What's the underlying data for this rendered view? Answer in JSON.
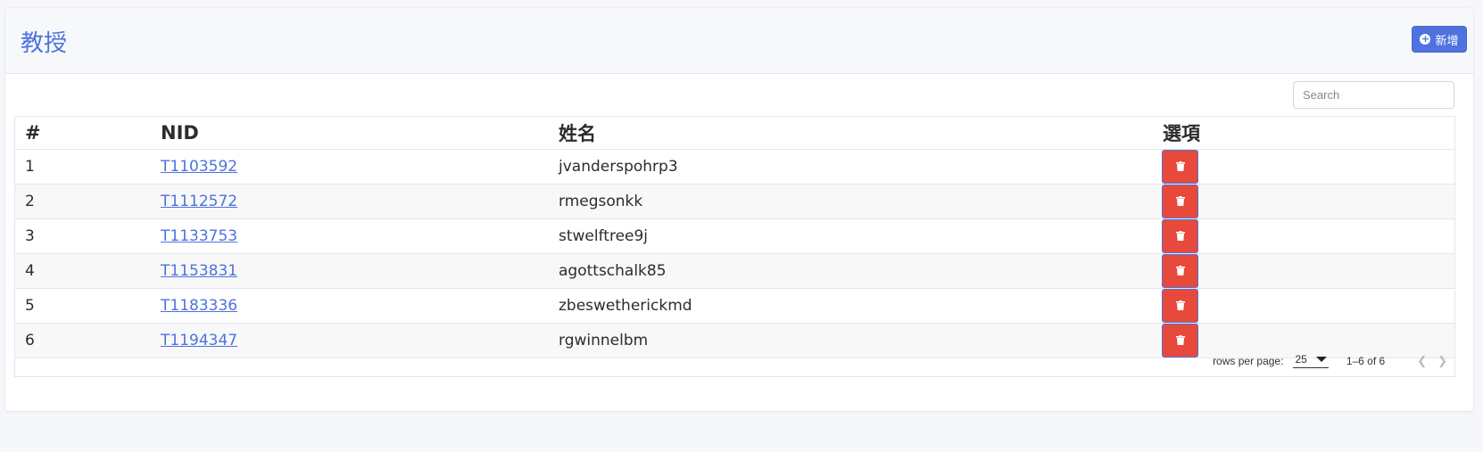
{
  "header": {
    "title": "教授",
    "add_label": "新增"
  },
  "search": {
    "placeholder": "Search"
  },
  "table": {
    "columns": [
      "#",
      "NID",
      "姓名",
      "選項"
    ],
    "rows": [
      {
        "idx": "1",
        "nid": "T1103592",
        "name": "jvanderspohrp3"
      },
      {
        "idx": "2",
        "nid": "T1112572",
        "name": "rmegsonkk"
      },
      {
        "idx": "3",
        "nid": "T1133753",
        "name": "stwelftree9j"
      },
      {
        "idx": "4",
        "nid": "T1153831",
        "name": "agottschalk85"
      },
      {
        "idx": "5",
        "nid": "T1183336",
        "name": "zbeswetherickmd"
      },
      {
        "idx": "6",
        "nid": "T1194347",
        "name": "rgwinnelbm"
      }
    ]
  },
  "pagination": {
    "rows_per_page_label": "rows per page:",
    "rows_per_page_value": "25",
    "range_text": "1–6 of 6"
  },
  "colors": {
    "accent": "#4e73df",
    "danger": "#e74a3b"
  },
  "icons": {
    "add": "plus-circle-icon",
    "delete": "trash-icon",
    "prev": "chevron-left-icon",
    "next": "chevron-right-icon"
  }
}
